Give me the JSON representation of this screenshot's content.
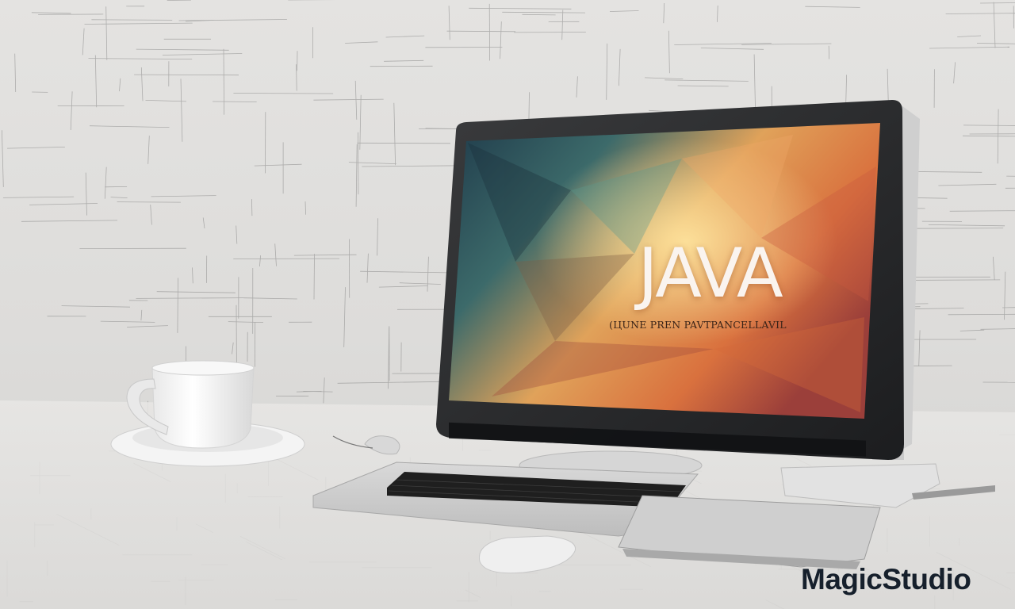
{
  "monitor_screen": {
    "title": "JAVA",
    "subtitle": "(ЦUNE PREN PAVTPANCELLAVIL"
  },
  "watermark": {
    "text": "MagicStudio"
  }
}
